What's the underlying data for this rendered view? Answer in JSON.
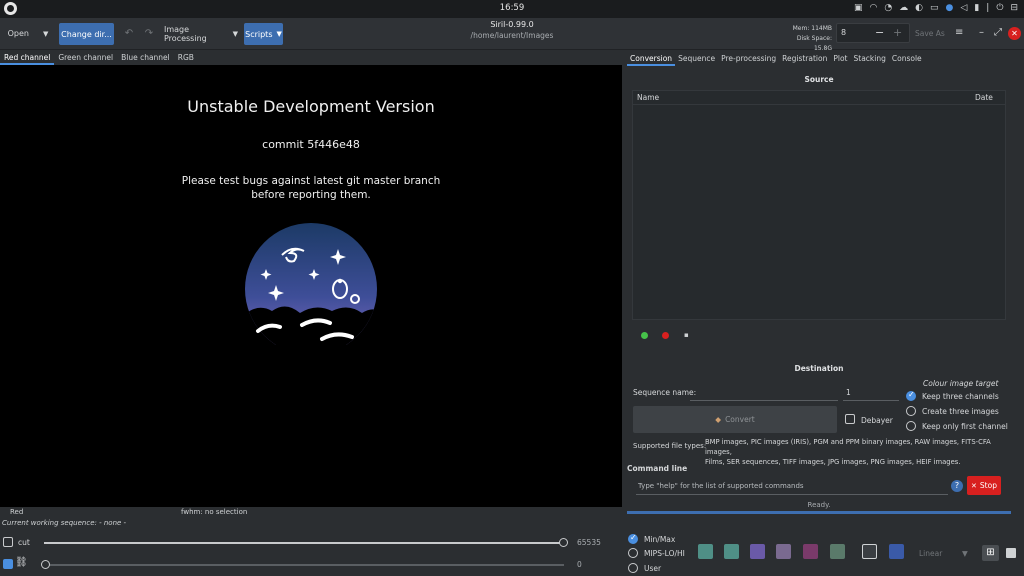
{
  "system": {
    "clock": "16:59"
  },
  "header": {
    "open_label": "Open",
    "change_dir_label": "Change dir...",
    "image_processing_label": "Image Processing",
    "scripts_label": "Scripts",
    "app_title": "Siril-0.99.0",
    "cwd": "/home/laurent/Images",
    "mem_label": "Mem: 114MB",
    "disk_label": "Disk Space: 15.8G",
    "threads_value": "8",
    "save_as_label": "Save As"
  },
  "viewer": {
    "tabs": [
      "Red channel",
      "Green channel",
      "Blue channel",
      "RGB"
    ],
    "line1": "Unstable Development Version",
    "line2": "commit 5f446e48",
    "line3": "Please test bugs against latest git master branch",
    "line4": "before reporting them.",
    "status_channel": "Red",
    "status_fwhm": "fwhm: no selection",
    "current_sequence": "Current working sequence: - none -"
  },
  "panel": {
    "tabs": [
      "Conversion",
      "Sequence",
      "Pre-processing",
      "Registration",
      "Plot",
      "Stacking",
      "Console"
    ],
    "source_title": "Source",
    "col_name": "Name",
    "col_date": "Date",
    "destination_title": "Destination",
    "sequence_name_label": "Sequence name:",
    "sequence_start": "1",
    "colour_target_label": "Colour image target",
    "radio_keep_three": "Keep three channels",
    "radio_create_three": "Create three images",
    "radio_keep_first": "Keep only first channel",
    "convert_label": "Convert",
    "debayer_label": "Debayer",
    "supported_label": "Supported file types:",
    "supported_line1": "BMP images, PIC images (IRIS), PGM and PPM binary images, RAW images, FITS-CFA images,",
    "supported_line2": "Films, SER sequences, TIFF images, JPG images, PNG images, HEIF images.",
    "command_line_title": "Command line",
    "command_placeholder": "Type \"help\" for the list of supported commands",
    "help_label": "?",
    "stop_label": "Stop",
    "ready_label": "Ready."
  },
  "bottom": {
    "cut_label": "cut",
    "max_value": "65535",
    "min_value": "0",
    "radio_minmax": "Min/Max",
    "radio_mips": "MIPS-LO/HI",
    "radio_user": "User",
    "display_mode": "Linear",
    "cut_slider_level": 1.0,
    "lo_slider_level": 0.0
  },
  "colors": {
    "accent": "#3d6eb0",
    "stop": "#d8201f",
    "bg": "#2b2e31"
  }
}
